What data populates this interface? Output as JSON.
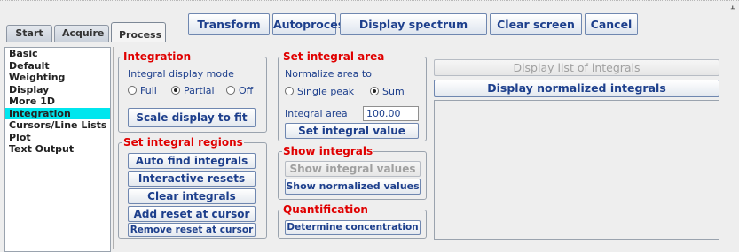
{
  "tabs": [
    {
      "label": "Start"
    },
    {
      "label": "Acquire"
    },
    {
      "label": "Process"
    }
  ],
  "toolbar": {
    "transform": "Transform",
    "autoprocess": "Autoprocess",
    "display_spectrum": "Display spectrum",
    "clear_screen": "Clear screen",
    "cancel": "Cancel"
  },
  "nav": {
    "items": [
      {
        "label": "Basic"
      },
      {
        "label": "Default"
      },
      {
        "label": "Weighting"
      },
      {
        "label": "Display"
      },
      {
        "label": "More 1D"
      },
      {
        "label": "Integration"
      },
      {
        "label": "Cursors/Line Lists"
      },
      {
        "label": "Plot"
      },
      {
        "label": "Text Output"
      }
    ],
    "selected": "Integration"
  },
  "integration": {
    "title": "Integration",
    "mode_label": "Integral display mode",
    "options": [
      "Full",
      "Partial",
      "Off"
    ],
    "selected": "Partial",
    "scale_button": "Scale display to fit"
  },
  "regions": {
    "title": "Set integral regions",
    "buttons": [
      "Auto find integrals",
      "Interactive resets",
      "Clear integrals",
      "Add reset at cursor",
      "Remove reset at cursor"
    ]
  },
  "area": {
    "title": "Set integral area",
    "normalize_label": "Normalize area to",
    "options": [
      "Single peak",
      "Sum"
    ],
    "selected": "Sum",
    "area_label": "Integral area",
    "area_value": "100.00",
    "set_button": "Set integral value"
  },
  "show": {
    "title": "Show integrals",
    "values_button": "Show integral values",
    "normalized_button": "Show normalized values"
  },
  "quant": {
    "title": "Quantification",
    "button": "Determine concentration"
  },
  "list": {
    "display_list_button": "Display list of integrals",
    "display_normalized_button": "Display normalized integrals"
  },
  "colors": {
    "accent_text": "#1d3f8c",
    "group_title": "#e00000",
    "selected_nav": "#00e6ee"
  }
}
